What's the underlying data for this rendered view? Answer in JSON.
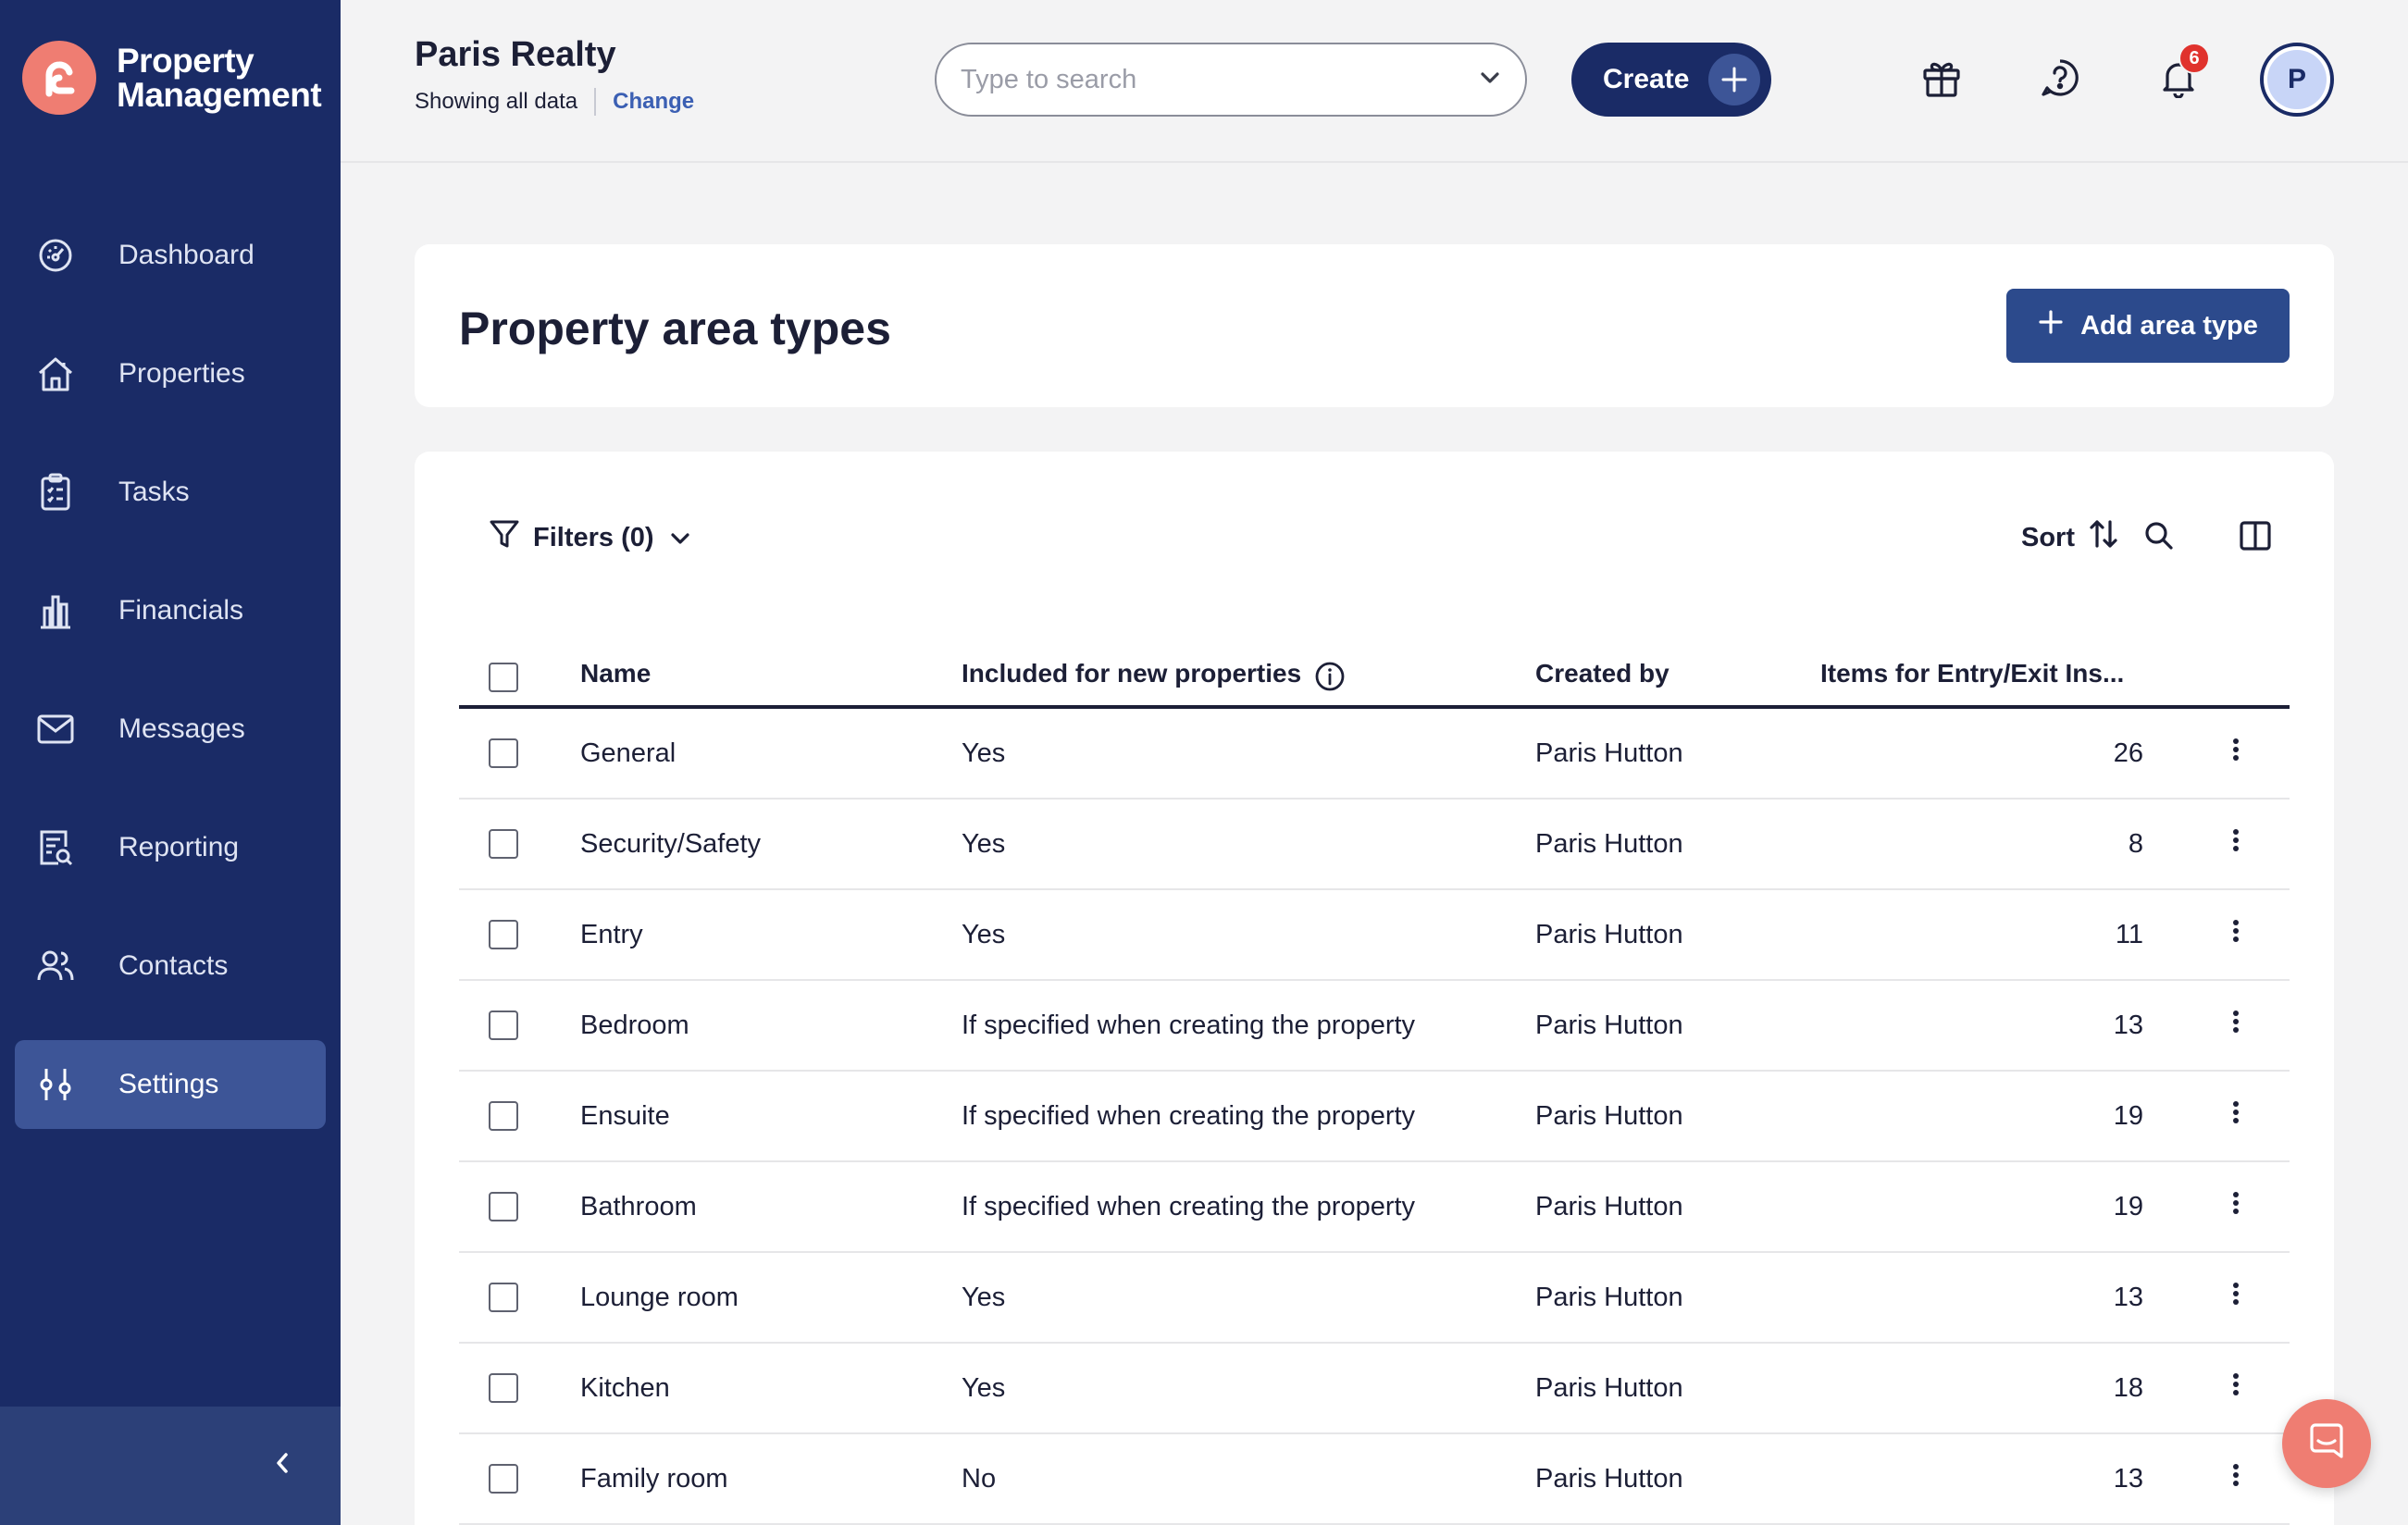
{
  "app": {
    "name_line1": "Property",
    "name_line2": "Management",
    "brand_color": "#1a2b66",
    "accent_color": "#ef7d72"
  },
  "sidebar": {
    "items": [
      {
        "label": "Dashboard",
        "icon": "dashboard-icon",
        "active": false
      },
      {
        "label": "Properties",
        "icon": "house-icon",
        "active": false
      },
      {
        "label": "Tasks",
        "icon": "clipboard-icon",
        "active": false
      },
      {
        "label": "Financials",
        "icon": "bank-icon",
        "active": false
      },
      {
        "label": "Messages",
        "icon": "envelope-icon",
        "active": false
      },
      {
        "label": "Reporting",
        "icon": "report-icon",
        "active": false
      },
      {
        "label": "Contacts",
        "icon": "people-icon",
        "active": false
      },
      {
        "label": "Settings",
        "icon": "sliders-icon",
        "active": true
      }
    ]
  },
  "header": {
    "org_name": "Paris Realty",
    "scope_text": "Showing all data",
    "change_link": "Change",
    "search_placeholder": "Type to search",
    "create_label": "Create",
    "notification_count": "6",
    "avatar_initial": "P"
  },
  "page": {
    "title": "Property area types",
    "add_button": "Add area type"
  },
  "toolbar": {
    "filters_label": "Filters (0)",
    "sort_label": "Sort"
  },
  "table": {
    "columns": {
      "name": "Name",
      "included": "Included for new properties",
      "created_by": "Created by",
      "items": "Items for Entry/Exit Ins..."
    },
    "rows": [
      {
        "name": "General",
        "included": "Yes",
        "created_by": "Paris Hutton",
        "items": "26"
      },
      {
        "name": "Security/Safety",
        "included": "Yes",
        "created_by": "Paris Hutton",
        "items": "8"
      },
      {
        "name": "Entry",
        "included": "Yes",
        "created_by": "Paris Hutton",
        "items": "11"
      },
      {
        "name": "Bedroom",
        "included": "If specified when creating the property",
        "created_by": "Paris Hutton",
        "items": "13"
      },
      {
        "name": "Ensuite",
        "included": "If specified when creating the property",
        "created_by": "Paris Hutton",
        "items": "19"
      },
      {
        "name": "Bathroom",
        "included": "If specified when creating the property",
        "created_by": "Paris Hutton",
        "items": "19"
      },
      {
        "name": "Lounge room",
        "included": "Yes",
        "created_by": "Paris Hutton",
        "items": "13"
      },
      {
        "name": "Kitchen",
        "included": "Yes",
        "created_by": "Paris Hutton",
        "items": "18"
      },
      {
        "name": "Family room",
        "included": "No",
        "created_by": "Paris Hutton",
        "items": "13"
      }
    ]
  }
}
